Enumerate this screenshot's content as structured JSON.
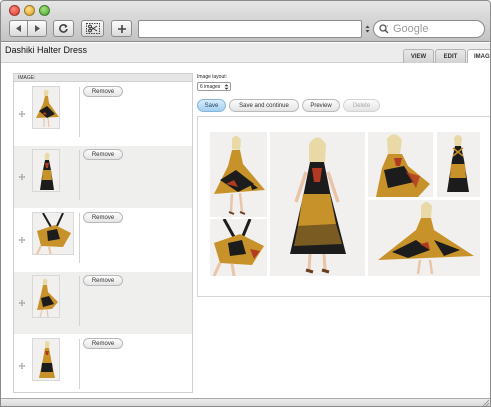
{
  "browser": {
    "back_icon": "back-arrow-icon",
    "forward_icon": "forward-arrow-icon",
    "reload_icon": "reload-icon",
    "snip_icon": "scissors-icon",
    "add_icon": "plus-icon",
    "url": "",
    "search_placeholder": "Google"
  },
  "page": {
    "title": "Dashiki Halter Dress"
  },
  "tabs": [
    {
      "label": "VIEW"
    },
    {
      "label": "EDIT"
    },
    {
      "label": "IMAG"
    }
  ],
  "image_list": {
    "header": "IMAGE:",
    "remove_label": "Remove",
    "items": [
      {
        "pose": "twirl"
      },
      {
        "pose": "front"
      },
      {
        "pose": "detail"
      },
      {
        "pose": "kneel"
      },
      {
        "pose": "walk"
      }
    ]
  },
  "layout_control": {
    "label": "Image layout:",
    "selected": "6 images"
  },
  "actions": {
    "save": "Save",
    "save_continue": "Save and continue",
    "preview": "Preview",
    "delete": "Delete"
  },
  "colors": {
    "accent_save": "#a4cff0",
    "dress_gold": "#c8922a",
    "dress_black": "#1c1c1c",
    "dress_red": "#b23a22",
    "skin": "#e8c4a8",
    "hair": "#e8d9a6"
  }
}
